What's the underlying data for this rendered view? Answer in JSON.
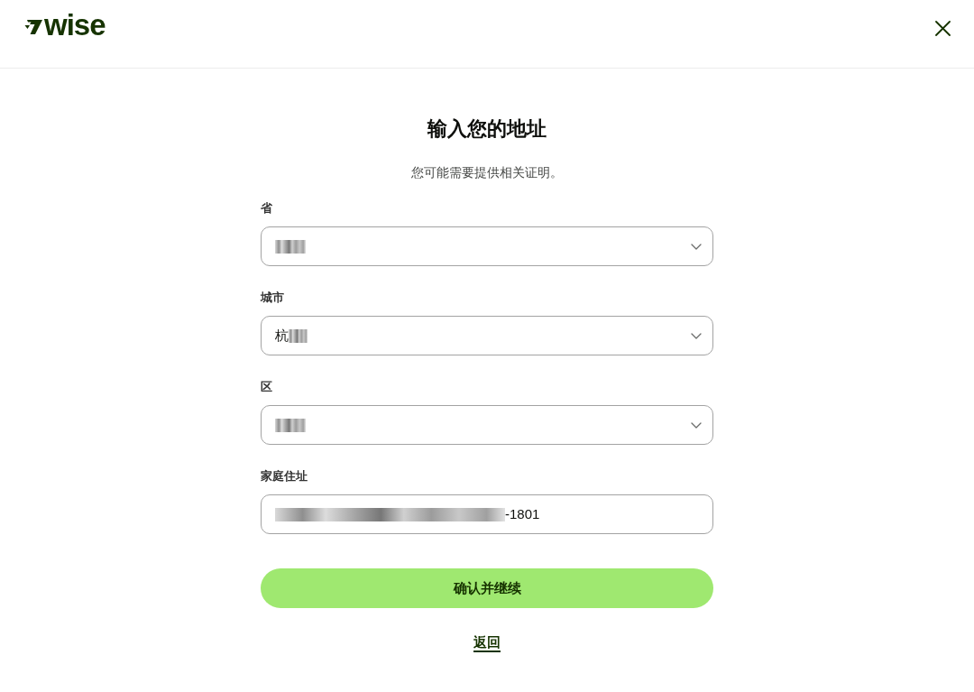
{
  "header": {
    "logo": "wise"
  },
  "title": "输入您的地址",
  "subtitle": "您可能需要提供相关证明。",
  "fields": [
    {
      "label": "省",
      "kind": "select",
      "blur_before": false,
      "blur_after": true
    },
    {
      "label": "城市",
      "kind": "select",
      "value": "杭",
      "blur_before": false,
      "blur_after": true
    },
    {
      "label": "区",
      "kind": "select",
      "blur_before": false,
      "blur_after": true
    },
    {
      "label": "家庭住址",
      "kind": "text",
      "value": "-1801",
      "blur_before": true,
      "blur_after": false
    }
  ],
  "primary_button": "确认并继续",
  "back_link": "返回"
}
